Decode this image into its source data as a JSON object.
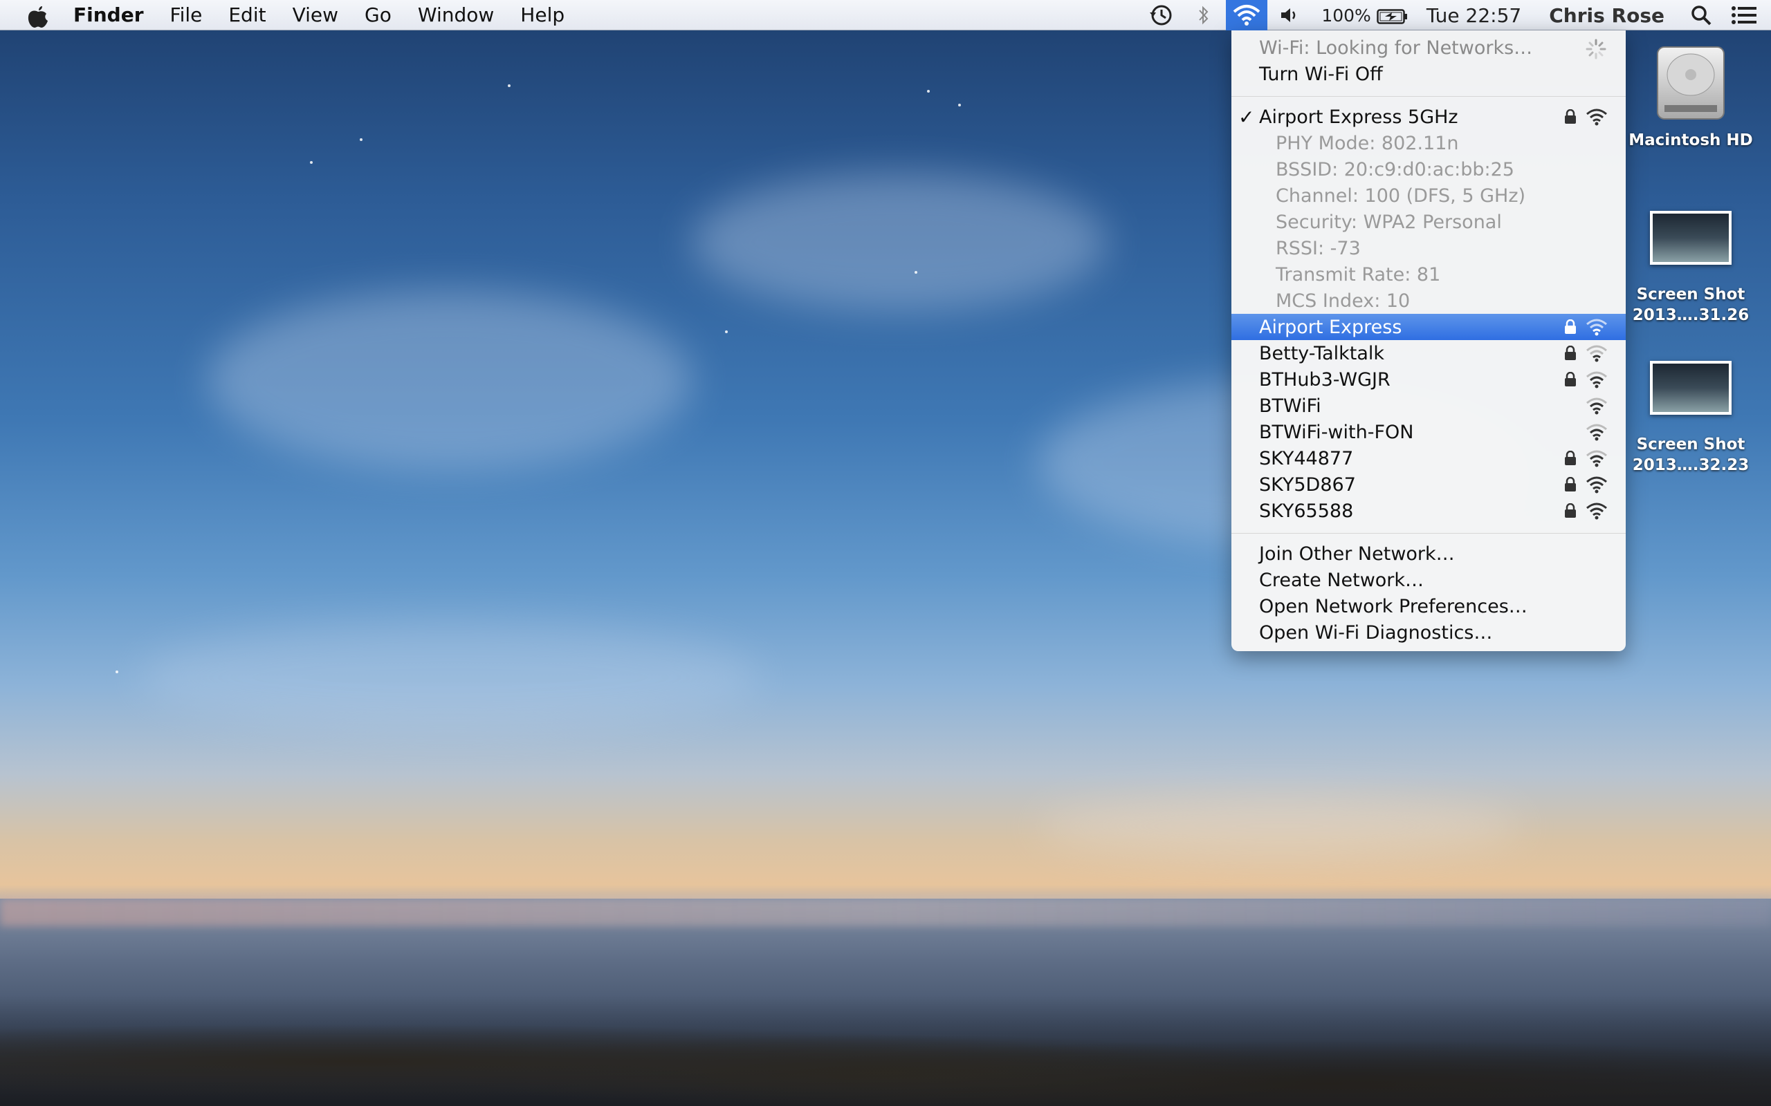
{
  "menubar": {
    "app_name": "Finder",
    "menus": [
      "File",
      "Edit",
      "View",
      "Go",
      "Window",
      "Help"
    ],
    "battery_percent": "100%",
    "clock": "Tue 22:57",
    "user": "Chris Rose"
  },
  "wifi_menu": {
    "status": "Wi-Fi: Looking for Networks…",
    "toggle": "Turn Wi-Fi Off",
    "connected": {
      "name": "Airport Express 5GHz",
      "details": [
        "PHY Mode: 802.11n",
        "BSSID: 20:c9:d0:ac:bb:25",
        "Channel: 100 (DFS, 5 GHz)",
        "Security: WPA2 Personal",
        "RSSI: -73",
        "Transmit Rate: 81",
        "MCS Index: 10"
      ]
    },
    "networks": [
      {
        "name": "Airport Express",
        "secured": true,
        "highlighted": true
      },
      {
        "name": "Betty-Talktalk",
        "secured": true
      },
      {
        "name": "BTHub3-WGJR",
        "secured": true
      },
      {
        "name": "BTWiFi",
        "secured": false
      },
      {
        "name": "BTWiFi-with-FON",
        "secured": false
      },
      {
        "name": "SKY44877",
        "secured": true
      },
      {
        "name": "SKY5D867",
        "secured": true
      },
      {
        "name": "SKY65588",
        "secured": true
      }
    ],
    "actions": [
      "Join Other Network…",
      "Create Network…",
      "Open Network Preferences…",
      "Open Wi-Fi Diagnostics…"
    ]
  },
  "desktop_icons": [
    {
      "label_line1": "Macintosh HD",
      "label_line2": ""
    },
    {
      "label_line1": "Screen Shot",
      "label_line2": "2013….31.26"
    },
    {
      "label_line1": "Screen Shot",
      "label_line2": "2013….32.23"
    }
  ],
  "colors": {
    "highlight": "#3476e0",
    "menubar": "#eef1f6"
  }
}
